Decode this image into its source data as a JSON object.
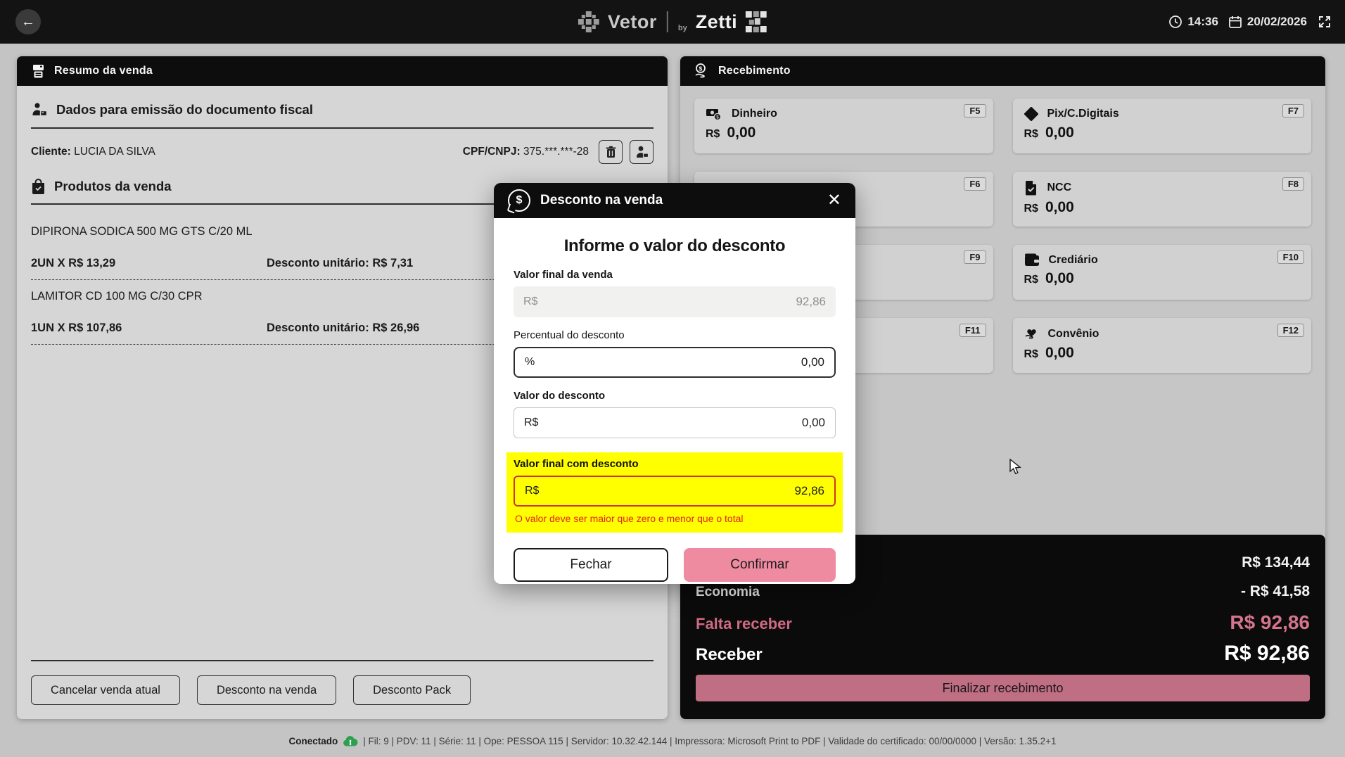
{
  "topbar": {
    "back": "←",
    "logo": {
      "brand": "Vetor",
      "by": "by",
      "suffix": "Zetti"
    },
    "time": "14:36",
    "date": "20/02/2026"
  },
  "sale_summary": {
    "title": "Resumo da venda",
    "fiscal_section_title": "Dados para emissão do documento fiscal",
    "client_label": "Cliente:",
    "client_name": " LUCIA DA SILVA",
    "cpf_label": "CPF/CNPJ:",
    "cpf_value": " 375.***.***-28",
    "products_title": "Produtos da venda",
    "products": [
      {
        "name": "DIPIRONA SODICA 500 MG GTS C/20 ML",
        "qty": "2UN X R$ 13,29",
        "discount_label": "Desconto unitário: ",
        "discount_value": "R$ 7,31"
      },
      {
        "name": "LAMITOR CD 100 MG C/30 CPR",
        "qty": "1UN X R$ 107,86",
        "discount_label": "Desconto unitário: ",
        "discount_value": "R$ 26,96"
      }
    ],
    "actions": {
      "cancel": "Cancelar venda atual",
      "discount_sale": "Desconto na venda",
      "discount_pack": "Desconto Pack"
    }
  },
  "receiving": {
    "title": "Recebimento",
    "tiles": [
      {
        "label": "Dinheiro",
        "key": "F5",
        "currency": "R$",
        "value": "0,00"
      },
      {
        "label": "Pix/C.Digitais",
        "key": "F7",
        "currency": "R$",
        "value": "0,00"
      },
      {
        "label": "",
        "key": "F6",
        "currency": "",
        "value": ""
      },
      {
        "label": "NCC",
        "key": "F8",
        "currency": "R$",
        "value": "0,00"
      },
      {
        "label": "",
        "key": "F9",
        "currency": "",
        "value": ""
      },
      {
        "label": "Crediário",
        "key": "F10",
        "currency": "R$",
        "value": "0,00"
      },
      {
        "label": "",
        "key": "F11",
        "currency": "",
        "value": ""
      },
      {
        "label": "Convênio",
        "key": "F12",
        "currency": "R$",
        "value": "0,00"
      }
    ],
    "totals": {
      "total_value": "R$ 134,44",
      "economy_label": "Economia",
      "economy_value": "- R$ 41,58",
      "remaining_label": "Falta receber",
      "remaining_value": "R$ 92,86",
      "receive_label": "Receber",
      "receive_value": "R$ 92,86",
      "finalize_button": "Finalizar recebimento"
    }
  },
  "modal": {
    "title": "Desconto na venda",
    "close": "✕",
    "heading": "Informe o valor do desconto",
    "fields": {
      "final_sale": {
        "label": "Valor final da venda",
        "prefix": "R$",
        "value": "92,86"
      },
      "percent": {
        "label": "Percentual do desconto",
        "prefix": "%",
        "value": "0,00"
      },
      "discount": {
        "label": "Valor do desconto",
        "prefix": "R$",
        "value": "0,00"
      },
      "final_with_discount": {
        "label": "Valor final com desconto",
        "prefix": "R$",
        "value": "92,86",
        "error": "O valor deve ser maior que zero e menor que o total"
      }
    },
    "close_button": "Fechar",
    "confirm_button": "Confirmar"
  },
  "statusbar": {
    "connected": "Conectado",
    "info": "| Fil: 9 | PDV: 11 | Série: 11 | Ope: PESSOA 115 | Servidor: 10.32.42.144 | Impressora: Microsoft Print to PDF | Validade do certificado: 00/00/0000 | Versão: 1.35.2+1"
  },
  "colors": {
    "topbar": "#131313",
    "accent_pink": "#ef8ba1",
    "finalize_pink": "#c06e84",
    "warning_yellow": "#ffff00",
    "error_red": "#e3231d",
    "connected_green": "#2e9e4f"
  }
}
